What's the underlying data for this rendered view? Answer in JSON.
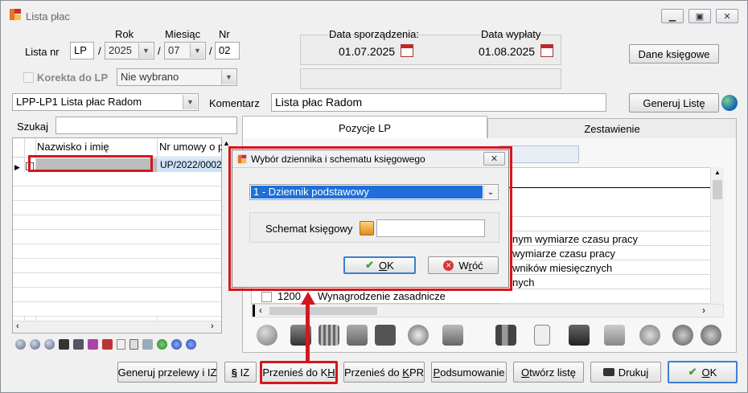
{
  "window": {
    "title": "Lista płac"
  },
  "header": {
    "lista_nr_label": "Lista nr",
    "rok_label": "Rok",
    "miesiac_label": "Miesiąc",
    "nr_label": "Nr",
    "prefix": "LP",
    "sep1": "/",
    "sep2": "/",
    "sep3": "/",
    "rok": "2025",
    "miesiac": "07",
    "nr": "02",
    "korekta_label": "Korekta  do LP",
    "korekta_value": "Nie wybrano",
    "data_sporzadzenia_label": "Data sporządzenia:",
    "data_sporzadzenia": "01.07.2025",
    "data_wyplaty_label": "Data wypłaty",
    "data_wyplaty": "01.08.2025",
    "dane_ksiegowe_button": "Dane księgowe",
    "lista_select": "LPP-LP1 Lista płac Radom",
    "komentarz_label": "Komentarz",
    "komentarz_value": "Lista płac Radom",
    "generuj_liste_button": "Generuj Listę"
  },
  "left": {
    "szukaj_label": "Szukaj",
    "columns": [
      "Nazwisko i imię",
      "Nr umowy o pracę"
    ],
    "row0_umowa": "UP/2022/0002"
  },
  "tabs": {
    "tab1": "Pozycje LP",
    "tab2": "Zestawienie"
  },
  "positions": [
    {
      "text": "nym wymiarze czasu pracy"
    },
    {
      "text": "wymiarze czasu pracy"
    },
    {
      "text": "wników miesięcznych"
    },
    {
      "text": "nych"
    }
  ],
  "last_row": {
    "code": "1200",
    "name": "Wynagrodzenie zasadnicze"
  },
  "dialog": {
    "title": "Wybór dziennika i schematu księgowego",
    "dziennik_value": "1 - Dziennik podstawowy",
    "schemat_label": "Schemat księgowy",
    "schemat_value": "",
    "ok_button": "OK",
    "ok_underline": "O",
    "ok_rest": "K",
    "wroc_button": "Wróć",
    "wroc_pre": "W",
    "wroc_u": "r",
    "wroc_post": "óć"
  },
  "footer": {
    "generuj_przelewy": "Generuj przelewy i IZ",
    "iz_label": "IZ",
    "przenies_kh_pre": "Przenieś do K",
    "przenies_kh_u": "H",
    "przenies_kpr_pre": "Przenieś do ",
    "przenies_kpr_u": "K",
    "przenies_kpr_post": "PR",
    "podsumowanie_pre": "",
    "podsumowanie_u": "P",
    "podsumowanie_post": "odsumowanie",
    "otworz_u": "O",
    "otworz_post": "twórz listę",
    "drukuj": "Drukuj",
    "ok": "OK",
    "ok_u": "O",
    "ok_post": "K"
  },
  "colors": {
    "selection": "#1e6fd9",
    "highlight": "#d4171d",
    "accent_green": "#3aa53a"
  }
}
